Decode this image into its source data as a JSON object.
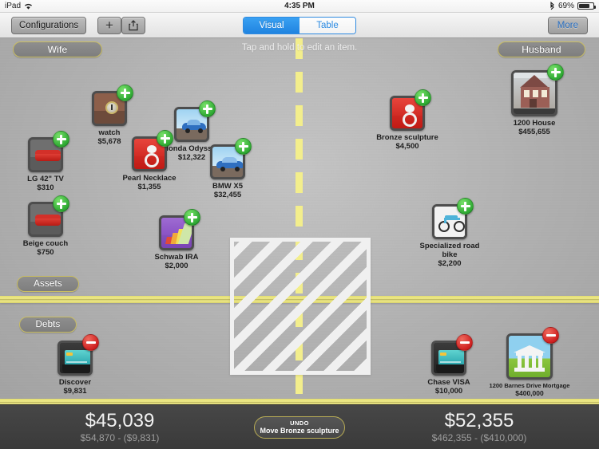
{
  "status_bar": {
    "carrier": "iPad",
    "wifi_icon": "wifi-icon",
    "time": "4:35 PM",
    "bluetooth_icon": "bluetooth-icon",
    "battery_text": "69%",
    "battery_icon": "battery-icon"
  },
  "toolbar": {
    "configurations_label": "Configurations",
    "add_label": "+",
    "share_icon": "share-icon",
    "segment": {
      "options": [
        "Visual",
        "Table"
      ],
      "selected": "Visual"
    },
    "more_label": "More"
  },
  "board": {
    "hint": "Tap and hold to edit an item.",
    "left_owner": "Wife",
    "right_owner": "Husband",
    "assets_label": "Assets",
    "debts_label": "Debts",
    "drop_zone": "drop-target"
  },
  "items": [
    {
      "name": "watch",
      "value": "$5,678",
      "badge": "add",
      "icon": "watch-icon",
      "side": "left",
      "group": "assets"
    },
    {
      "name": "Honda Odyssey",
      "value": "$12,322",
      "badge": "add",
      "icon": "car-icon",
      "side": "left",
      "group": "assets"
    },
    {
      "name": "LG 42\" TV",
      "value": "$310",
      "badge": "add",
      "icon": "couch-icon",
      "side": "left",
      "group": "assets"
    },
    {
      "name": "Pearl Necklace",
      "value": "$1,355",
      "badge": "add",
      "icon": "jewelry-icon",
      "side": "left",
      "group": "assets"
    },
    {
      "name": "BMW X5",
      "value": "$32,455",
      "badge": "add",
      "icon": "car-icon",
      "side": "left",
      "group": "assets"
    },
    {
      "name": "Beige couch",
      "value": "$750",
      "badge": "add",
      "icon": "couch-icon",
      "side": "left",
      "group": "assets"
    },
    {
      "name": "Schwab IRA",
      "value": "$2,000",
      "badge": "add",
      "icon": "chart-icon",
      "side": "left",
      "group": "assets"
    },
    {
      "name": "Bronze sculpture",
      "value": "$4,500",
      "badge": "add",
      "icon": "jewelry-icon",
      "side": "right",
      "group": "assets"
    },
    {
      "name": "1200 House",
      "value": "$455,655",
      "badge": "add",
      "icon": "house-icon",
      "side": "right",
      "group": "assets"
    },
    {
      "name": "Specialized road bike",
      "value": "$2,200",
      "badge": "add",
      "icon": "bicycle-icon",
      "side": "right",
      "group": "assets"
    },
    {
      "name": "Discover",
      "value": "$9,831",
      "badge": "sub",
      "icon": "credit-card-icon",
      "side": "left",
      "group": "debts"
    },
    {
      "name": "Chase VISA",
      "value": "$10,000",
      "badge": "sub",
      "icon": "credit-card-icon",
      "side": "right",
      "group": "debts"
    },
    {
      "name": "1200 Barnes Drive Mortgage",
      "value": "$400,000",
      "badge": "sub",
      "icon": "bank-icon",
      "side": "right",
      "group": "debts"
    }
  ],
  "footer": {
    "left": {
      "net": "$45,039",
      "breakdown": "$54,870 - ($9,831)"
    },
    "right": {
      "net": "$52,355",
      "breakdown": "$462,355 - ($410,000)"
    },
    "undo": {
      "title": "UNDO",
      "action": "Move Bronze sculpture"
    }
  },
  "colors": {
    "accent_blue": "#2a8ae2",
    "road_yellow": "#f0eb8a",
    "add_green": "#2faa33",
    "sub_red": "#cf2020"
  }
}
